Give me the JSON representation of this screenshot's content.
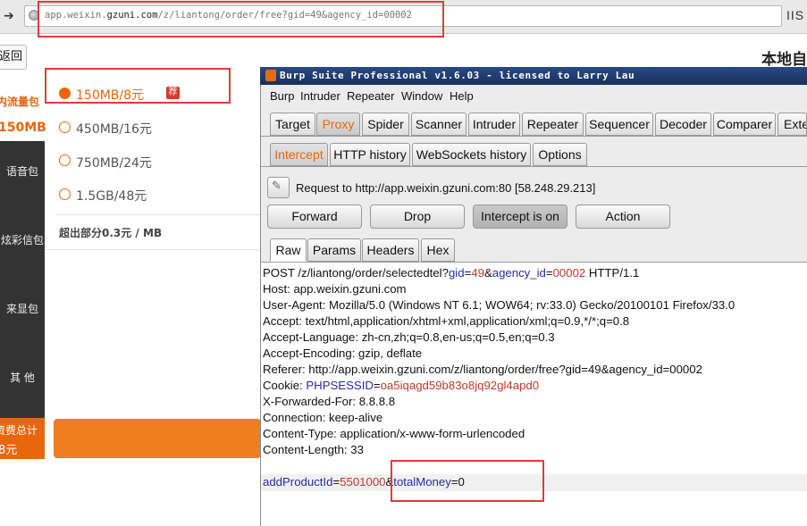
{
  "browser": {
    "url_prefix": "app.weixin.",
    "url_domain": "gzuni.com",
    "url_path": "/z/liantong/order/free?gid=49&agency_id=00002",
    "right_label": "IIS"
  },
  "page": {
    "back_label": "返回",
    "heading": "本地自",
    "nav_flow_label": "内流量包",
    "nav_flow_size": "150MB",
    "nav_items": [
      "语音包",
      "炫彩信包",
      "来显包",
      "其 他"
    ],
    "total_label": "资费总计",
    "total_value": "8元",
    "packages": [
      {
        "label": "150MB/8元",
        "selected": true
      },
      {
        "label": "450MB/16元",
        "selected": false
      },
      {
        "label": "750MB/24元",
        "selected": false
      },
      {
        "label": "1.5GB/48元",
        "selected": false
      }
    ],
    "package_tag": "荐",
    "overflow_note": "超出部分0.3元 / MB"
  },
  "burp": {
    "title": "Burp Suite Professional v1.6.03 - licensed to  Larry Lau",
    "menu": [
      "Burp",
      "Intruder",
      "Repeater",
      "Window",
      "Help"
    ],
    "tabs": [
      "Target",
      "Proxy",
      "Spider",
      "Scanner",
      "Intruder",
      "Repeater",
      "Sequencer",
      "Decoder",
      "Comparer",
      "Exte"
    ],
    "active_tab": "Proxy",
    "subtabs": [
      "Intercept",
      "HTTP history",
      "WebSockets history",
      "Options"
    ],
    "active_subtab": "Intercept",
    "request_info": "Request to http://app.weixin.gzuni.com:80  [58.248.29.213]",
    "buttons": {
      "forward": "Forward",
      "drop": "Drop",
      "intercept": "Intercept is on",
      "action": "Action"
    },
    "view_tabs": [
      "Raw",
      "Params",
      "Headers",
      "Hex"
    ],
    "active_view": "Raw",
    "request": {
      "line_method": "POST /z/liantong/order/selectedtel?",
      "line_p1": "gid",
      "line_v1": "49",
      "line_p2": "agency_id",
      "line_v2": "00002",
      "line_tail": " HTTP/1.1",
      "host": "Host: app.weixin.gzuni.com",
      "user_agent": "User-Agent: Mozilla/5.0 (Windows NT 6.1; WOW64; rv:33.0) Gecko/20100101 Firefox/33.0",
      "accept": "Accept: text/html,application/xhtml+xml,application/xml;q=0.9,*/*;q=0.8",
      "accept_language": "Accept-Language: zh-cn,zh;q=0.8,en-us;q=0.5,en;q=0.3",
      "accept_encoding": "Accept-Encoding: gzip, deflate",
      "referer": "Referer: http://app.weixin.gzuni.com/z/liantong/order/free?gid=49&agency_id=00002",
      "cookie_prefix": "Cookie: ",
      "cookie_name": "PHPSESSID",
      "cookie_value": "oa5iqagd59b83o8jq92gl4apd0",
      "xff": "X-Forwarded-For: 8.8.8.8",
      "connection": "Connection: keep-alive",
      "content_type": "Content-Type: application/x-www-form-urlencoded",
      "content_length": "Content-Length: 33",
      "body_p1": "addProductId",
      "body_v1": "5501000",
      "body_p2": "totalMoney",
      "body_v2": "0"
    }
  },
  "colors": {
    "orange": "#e8670d",
    "highlight_red": "#e33b3b",
    "burp_title": "#17305e",
    "param_blue": "#2a2aa8",
    "value_red": "#c0392b"
  }
}
